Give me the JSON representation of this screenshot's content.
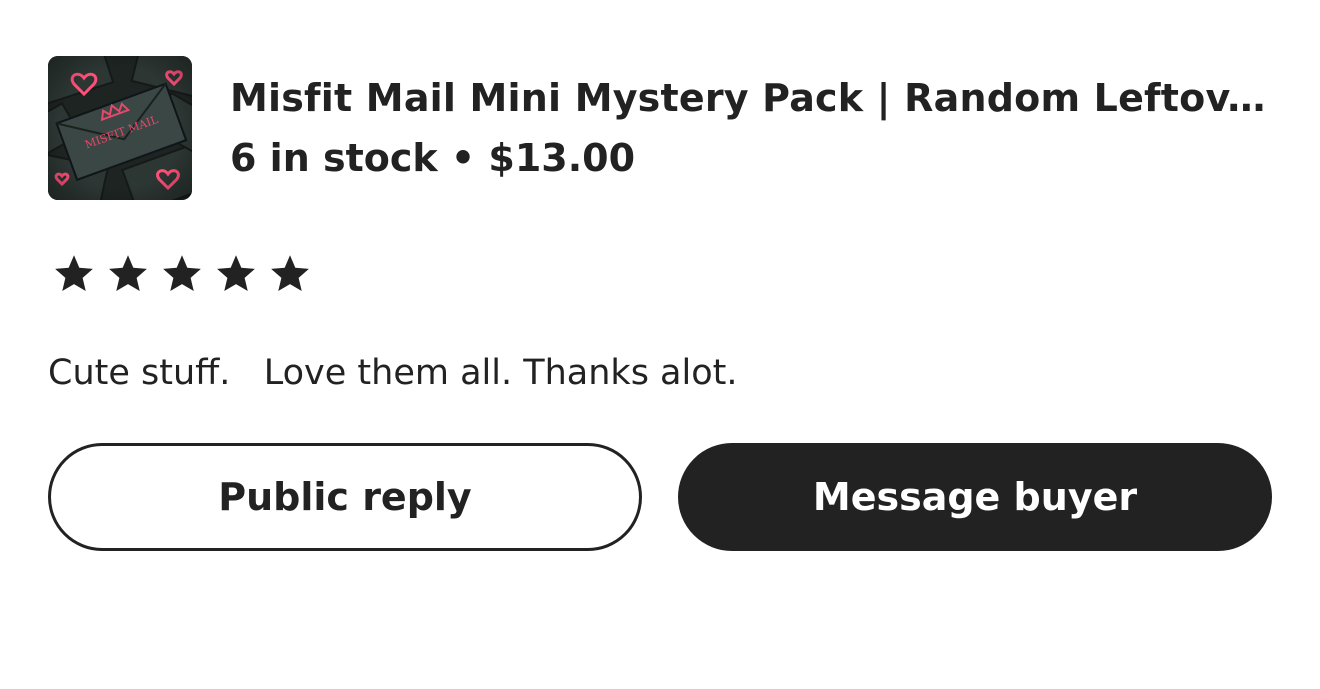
{
  "product": {
    "title": "Misfit Mail Mini Mystery Pack | Random Leftov...",
    "stock_price": "6 in stock • $13.00",
    "thumbnail": {
      "label": "MISFIT MAIL"
    }
  },
  "review": {
    "rating": 5,
    "max_rating": 5,
    "text": "Cute stuff.   Love them all. Thanks alot."
  },
  "actions": {
    "public_reply_label": "Public reply",
    "message_buyer_label": "Message buyer"
  },
  "colors": {
    "text": "#222222",
    "button_dark": "#222222",
    "background": "#ffffff",
    "thumb_accent": "#e8476b"
  }
}
